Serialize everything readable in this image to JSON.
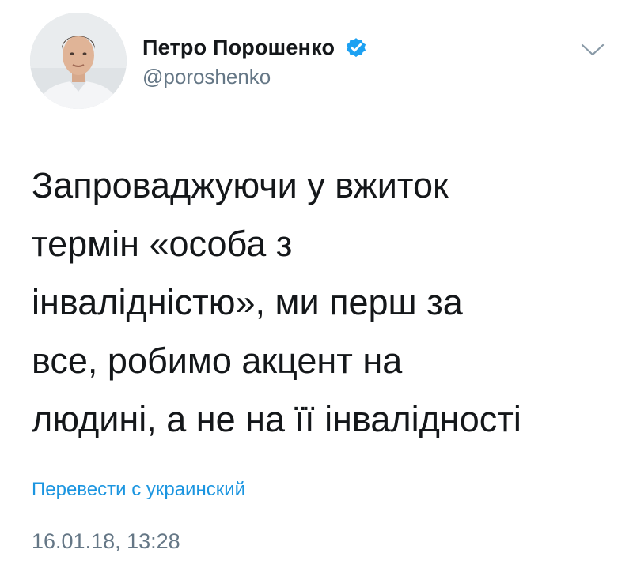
{
  "user": {
    "display_name": "Петро Порошенко",
    "handle": "@poroshenko",
    "verified": true,
    "avatar_icon": "profile-photo"
  },
  "tweet": {
    "text_lines": [
      "Запроваджуючи у вжиток",
      "термін «особа з",
      "інвалідністю», ми перш за",
      "все, робимо акцент на",
      "людині, а не на її інвалідності"
    ],
    "translate_label": "Перевести с украинский",
    "timestamp": "16.01.18, 13:28"
  },
  "icons": {
    "verified": "verified-badge-icon",
    "menu": "chevron-down-icon"
  },
  "colors": {
    "text": "#14171a",
    "secondary": "#657786",
    "link": "#1b95e0",
    "verified": "#1da1f2"
  }
}
